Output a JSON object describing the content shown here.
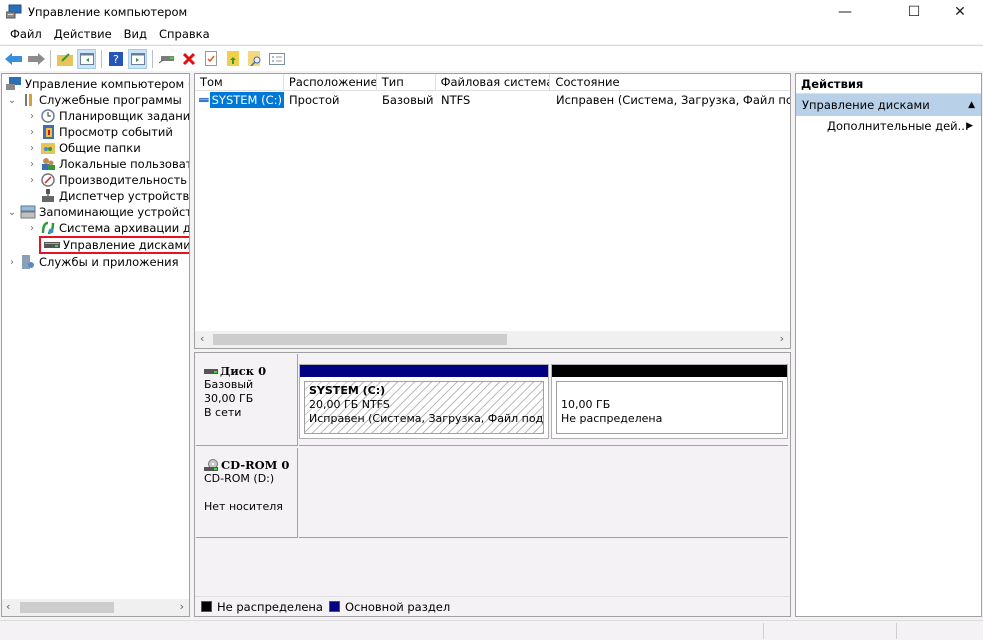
{
  "window": {
    "title": "Управление компьютером",
    "controls": {
      "minimize": "—",
      "maximize": "☐",
      "close": "✕"
    }
  },
  "menu": [
    "Файл",
    "Действие",
    "Вид",
    "Справка"
  ],
  "toolbar": {
    "icons": [
      "back-icon",
      "forward-icon",
      "up-folder-icon",
      "show-hide-console-tree-icon",
      "help-icon",
      "show-hide-action-pane-icon",
      "connect-drive-icon",
      "delete-icon",
      "properties-icon",
      "export-icon",
      "find-icon",
      "checklist-icon"
    ]
  },
  "tree": {
    "items": [
      {
        "label": "Управление компьютером (л",
        "level": 0,
        "chevron": "",
        "icon": "computer-management-icon"
      },
      {
        "label": "Служебные программы",
        "level": 1,
        "chevron": "⌄",
        "icon": "tools-icon"
      },
      {
        "label": "Планировщик заданий",
        "level": 2,
        "chevron": "›",
        "icon": "clock-icon"
      },
      {
        "label": "Просмотр событий",
        "level": 2,
        "chevron": "›",
        "icon": "event-viewer-icon"
      },
      {
        "label": "Общие папки",
        "level": 2,
        "chevron": "›",
        "icon": "shared-folders-icon"
      },
      {
        "label": "Локальные пользовате",
        "level": 2,
        "chevron": "›",
        "icon": "users-icon"
      },
      {
        "label": "Производительность",
        "level": 2,
        "chevron": "›",
        "icon": "performance-icon"
      },
      {
        "label": "Диспетчер устройств",
        "level": 2,
        "chevron": "",
        "icon": "device-manager-icon"
      },
      {
        "label": "Запоминающие устройст",
        "level": 1,
        "chevron": "⌄",
        "icon": "storage-icon"
      },
      {
        "label": "Система архивации да",
        "level": 2,
        "chevron": "›",
        "icon": "backup-icon"
      },
      {
        "label": "Управление дисками",
        "level": 2,
        "chevron": "",
        "icon": "disk-management-icon",
        "selected": true
      },
      {
        "label": "Службы и приложения",
        "level": 1,
        "chevron": "›",
        "icon": "services-icon"
      }
    ]
  },
  "volume_list": {
    "columns": [
      "Том",
      "Расположение",
      "Тип",
      "Файловая система",
      "Состояние"
    ],
    "rows": [
      {
        "volume": "SYSTEM (C:)",
        "layout": "Простой",
        "type": "Базовый",
        "fs": "NTFS",
        "status": "Исправен (Система, Загрузка, Файл подка"
      }
    ]
  },
  "disks": [
    {
      "name": "Диск 0",
      "type": "Базовый",
      "size": "30,00 ГБ",
      "state": "В сети",
      "partitions": [
        {
          "title": "SYSTEM  (C:)",
          "size": "20,00 ГБ NTFS",
          "status": "Исправен (Система, Загрузка, Файл подкач",
          "color": "#000080",
          "hatched": true
        },
        {
          "title": "",
          "size": "10,00 ГБ",
          "status": "Не распределена",
          "color": "#000000",
          "hatched": false
        }
      ]
    },
    {
      "name": "CD-ROM 0",
      "type": "CD-ROM (D:)",
      "state": "Нет носителя"
    }
  ],
  "legend": [
    {
      "label": "Не распределена",
      "color": "#000000"
    },
    {
      "label": "Основной раздел",
      "color": "#000080"
    }
  ],
  "actions": {
    "header": "Действия",
    "group": "Управление дисками",
    "items": [
      "Дополнительные дей..."
    ]
  }
}
